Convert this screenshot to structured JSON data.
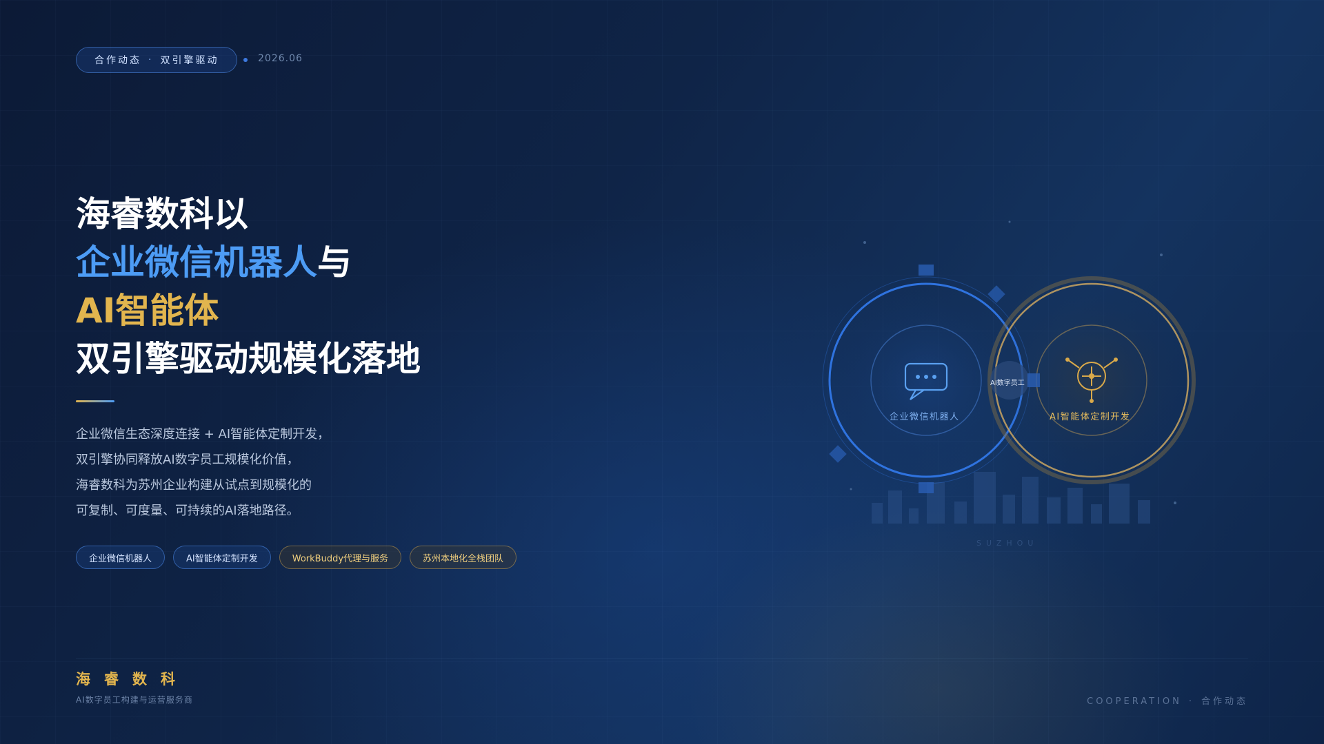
{
  "header": {
    "tag_left": "合作动态",
    "tag_sep": "·",
    "tag_right": "双引擎驱动",
    "date": "2026.06"
  },
  "headline": {
    "line1": "海睿数科以",
    "line2_highlight": "企业微信机器人",
    "line2_tail": "与",
    "line3": "AI智能体",
    "line4": "双引擎驱动规模化落地"
  },
  "description": [
    "企业微信生态深度连接 + AI智能体定制开发，",
    "双引擎协同释放AI数字员工规模化价值，",
    "海睿数科为苏州企业构建从试点到规模化的",
    "可复制、可度量、可持续的AI落地路径。"
  ],
  "chips": [
    {
      "label": "企业微信机器人",
      "style": "blue"
    },
    {
      "label": "AI智能体定制开发",
      "style": "blue"
    },
    {
      "label": "WorkBuddy代理与服务",
      "style": "gold"
    },
    {
      "label": "苏州本地化全栈团队",
      "style": "gold"
    }
  ],
  "diagram": {
    "left_node": "企业微信机器人",
    "right_node": "AI智能体定制开发",
    "center": "AI数字员工",
    "city": "SUZHOU",
    "left_icon": "chat-bubble-icon",
    "right_icon": "network-node-icon"
  },
  "footer": {
    "brand": "海睿数科",
    "brand_sub": "AI数字员工构建与运营服务商",
    "right_en": "COOPERATION",
    "right_sep": "·",
    "right_cn": "合作动态"
  },
  "colors": {
    "accent_blue": "#4d9cf5",
    "accent_gold": "#e2b54e",
    "background": "#0f2447"
  }
}
